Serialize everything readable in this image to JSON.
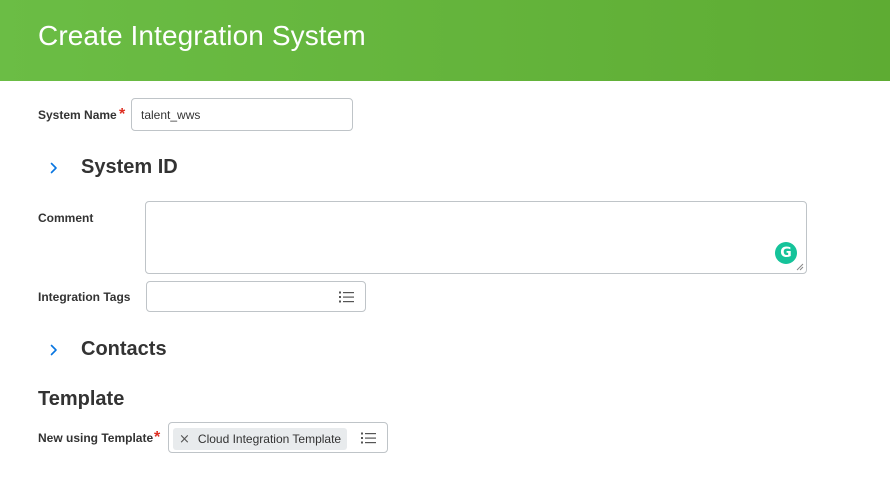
{
  "header": {
    "title": "Create Integration System"
  },
  "system_name": {
    "label": "System Name",
    "required_mark": "*",
    "value": "talent_wws"
  },
  "system_id_section": {
    "title": "System ID",
    "icon": "chevron-right-icon"
  },
  "comment": {
    "label": "Comment",
    "value": "",
    "grammarly_glyph": "G"
  },
  "integration_tags": {
    "label": "Integration Tags",
    "icon": "list-icon"
  },
  "contacts_section": {
    "title": "Contacts",
    "icon": "chevron-right-icon"
  },
  "template_section": {
    "title": "Template"
  },
  "new_using_template": {
    "label": "New using Template",
    "required_mark": "*",
    "remove_glyph": "×",
    "selected": "Cloud Integration Template",
    "icon": "list-icon"
  },
  "colors": {
    "header": "#64b43c",
    "required": "#de2e21",
    "accent": "#0875e1",
    "pill": "#e8ebed"
  }
}
